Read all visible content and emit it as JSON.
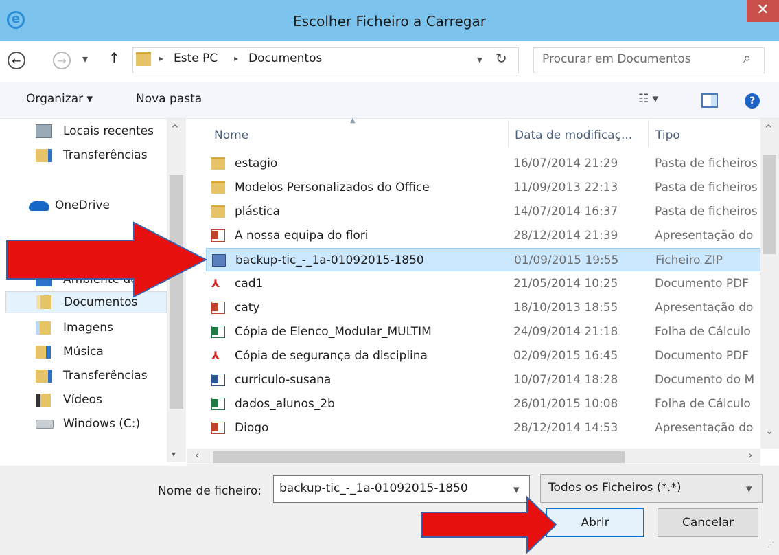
{
  "window": {
    "title": "Escolher Ficheiro a Carregar",
    "close_glyph": "✕"
  },
  "address": {
    "back_glyph": "←",
    "forward_glyph": "→",
    "dropdown_glyph": "▾",
    "up_glyph": "↑",
    "sep_glyph": "▸",
    "crumbs": [
      "Este PC",
      "Documentos"
    ],
    "refresh_glyph": "↻",
    "search_placeholder": "Procurar em Documentos",
    "search_glyph": "⌕"
  },
  "toolbar": {
    "organize": "Organizar ▾",
    "new_folder": "Nova pasta",
    "view_glyph": "☷ ▾",
    "help_glyph": "?"
  },
  "nav": {
    "items": [
      {
        "label": "Locais recentes",
        "icon": "recent-places-icon"
      },
      {
        "label": "Transferências",
        "icon": "downloads-icon"
      },
      {
        "label": "OneDrive",
        "icon": "onedrive-icon"
      },
      {
        "label": "Ambiente de trab",
        "icon": "desktop-icon"
      },
      {
        "label": "Documentos",
        "icon": "documents-icon"
      },
      {
        "label": "Imagens",
        "icon": "pictures-icon"
      },
      {
        "label": "Música",
        "icon": "music-icon"
      },
      {
        "label": "Transferências",
        "icon": "downloads-icon"
      },
      {
        "label": "Vídeos",
        "icon": "videos-icon"
      },
      {
        "label": "Windows (C:)",
        "icon": "drive-icon"
      }
    ]
  },
  "columns": {
    "name": "Nome",
    "date": "Data de modificaç...",
    "type": "Tipo"
  },
  "files": [
    {
      "name": "estagio",
      "date": "16/07/2014 21:29",
      "type": "Pasta de ficheiros",
      "kind": "folder"
    },
    {
      "name": "Modelos Personalizados do Office",
      "date": "11/09/2013 22:13",
      "type": "Pasta de ficheiros",
      "kind": "folder"
    },
    {
      "name": "plástica",
      "date": "14/07/2014 16:37",
      "type": "Pasta de ficheiros",
      "kind": "folder"
    },
    {
      "name": "A nossa equipa do flori",
      "date": "28/12/2014 21:39",
      "type": "Apresentação do",
      "kind": "ppt"
    },
    {
      "name": "backup-tic_-_1a-01092015-1850",
      "date": "01/09/2015 19:55",
      "type": "Ficheiro ZIP",
      "kind": "zip"
    },
    {
      "name": "cad1",
      "date": "21/05/2014 10:25",
      "type": "Documento PDF",
      "kind": "pdf"
    },
    {
      "name": "caty",
      "date": "18/10/2013 18:55",
      "type": "Apresentação do",
      "kind": "ppt"
    },
    {
      "name": "Cópia de Elenco_Modular_MULTIM",
      "date": "24/09/2014 21:18",
      "type": "Folha de Cálculo",
      "kind": "xls"
    },
    {
      "name": "Cópia de segurança da disciplina",
      "date": "02/09/2015 16:45",
      "type": "Documento PDF",
      "kind": "pdf"
    },
    {
      "name": "curriculo-susana",
      "date": "10/07/2014 18:28",
      "type": "Documento do M",
      "kind": "doc"
    },
    {
      "name": "dados_alunos_2b",
      "date": "26/01/2015 10:08",
      "type": "Folha de Cálculo",
      "kind": "xls"
    },
    {
      "name": "Diogo",
      "date": "28/12/2014 14:53",
      "type": "Apresentação do",
      "kind": "ppt"
    }
  ],
  "bottom": {
    "filename_label": "Nome de ficheiro:",
    "filename_value": "backup-tic_-_1a-01092015-1850",
    "filetype_value": "Todos os Ficheiros (*.*)",
    "open_label": "Abrir",
    "cancel_label": "Cancelar"
  },
  "colors": {
    "titlebar": "#7cc4ed",
    "close": "#c7504a",
    "selection": "#cce8ff",
    "annotation_arrow": "#e8100f"
  }
}
